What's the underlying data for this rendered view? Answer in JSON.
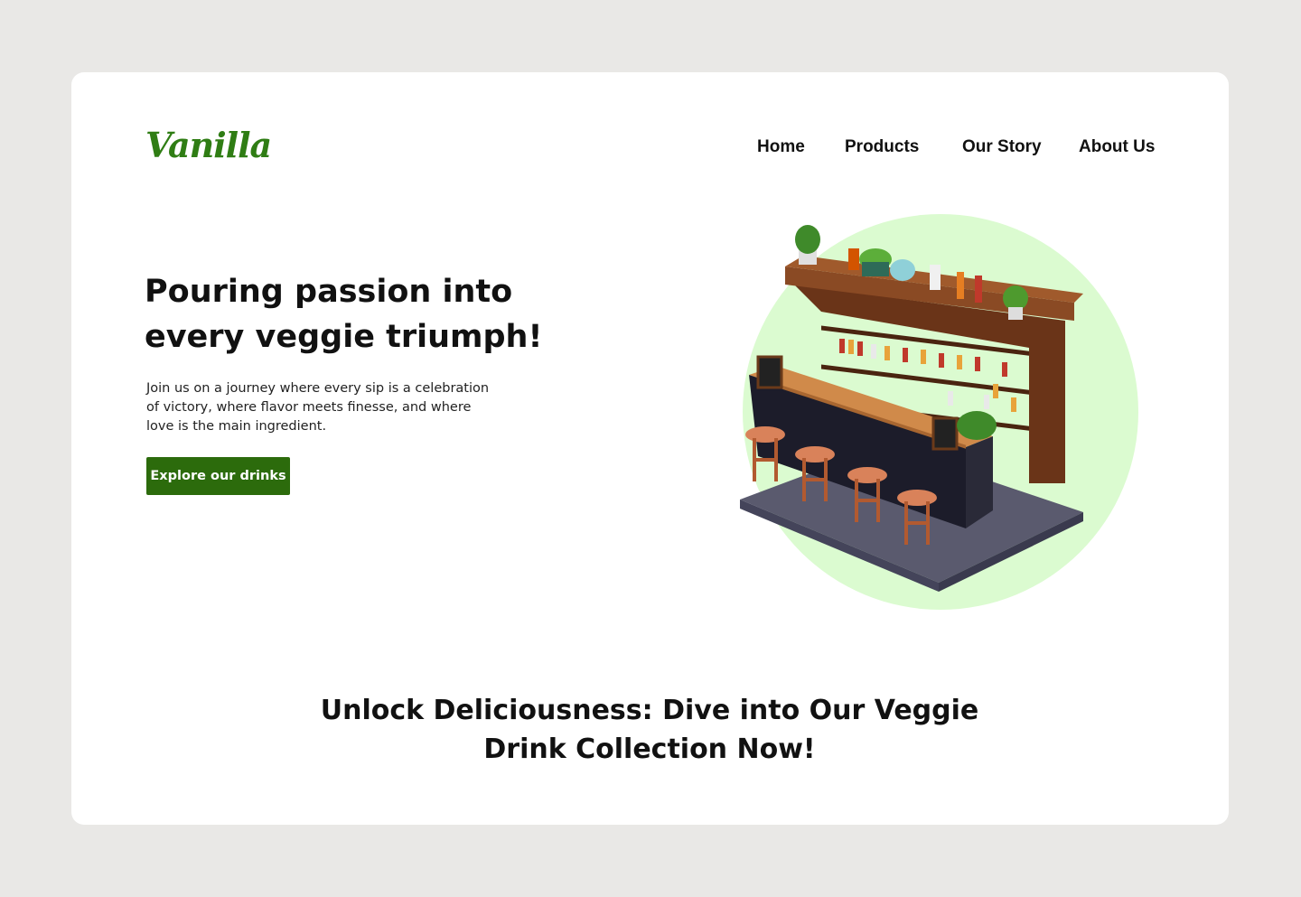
{
  "brand": {
    "logo_text": "Vanilla",
    "accent_color": "#2f7d14"
  },
  "nav": {
    "items": [
      "Home",
      "Products",
      "Our Story",
      "About Us"
    ]
  },
  "hero": {
    "title": "Pouring passion into every veggie triumph!",
    "description": "Join us on a journey where every sip is a celebration of victory, where flavor meets finesse, and where love is the main ingredient.",
    "cta_label": "Explore our drinks",
    "cta_color": "#2c6b0c",
    "image_circle_color": "#dbfbd0",
    "image_subject": "isometric-bar-counter-illustration"
  },
  "section": {
    "title": "Unlock Deliciousness: Dive into Our Veggie Drink Collection Now!"
  }
}
